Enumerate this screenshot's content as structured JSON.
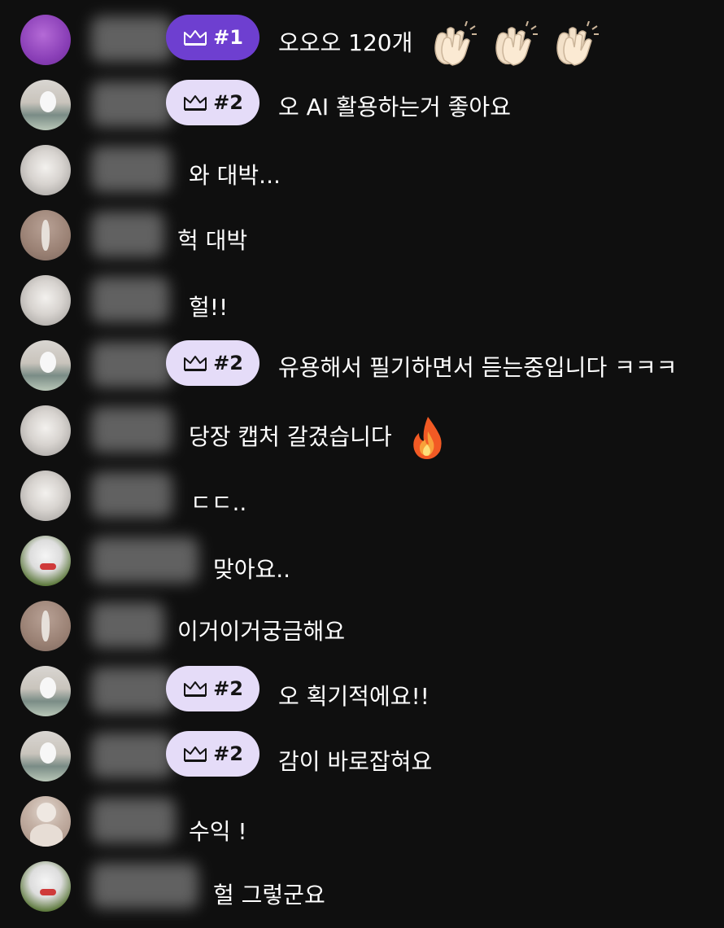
{
  "chat": {
    "messages": [
      {
        "badge": "#1",
        "text": "오오오 120개",
        "emojis": [
          "clapping-hands-icon",
          "clapping-hands-icon",
          "clapping-hands-icon"
        ]
      },
      {
        "badge": "#2",
        "text": "오 AI 활용하는거 좋아요"
      },
      {
        "badge": null,
        "text": "와 대박..."
      },
      {
        "badge": null,
        "text": "헉 대박"
      },
      {
        "badge": null,
        "text": "헐!!"
      },
      {
        "badge": "#2",
        "text": "유용해서 필기하면서 듣는중입니다 ㅋㅋㅋ"
      },
      {
        "badge": null,
        "text": "당장 캡처 갈겼습니다",
        "emojis": [
          "fire-icon"
        ]
      },
      {
        "badge": null,
        "text": "ㄷㄷ.."
      },
      {
        "badge": null,
        "text": "맞아요.."
      },
      {
        "badge": null,
        "text": "이거이거궁금해요"
      },
      {
        "badge": "#2",
        "text": "오 획기적에요!!"
      },
      {
        "badge": "#2",
        "text": "감이 바로잡혀요"
      },
      {
        "badge": null,
        "text": "수익 !"
      },
      {
        "badge": null,
        "text": "헐 그렇군요"
      }
    ]
  },
  "colors": {
    "background": "#0f0f0f",
    "rank1_badge": "#6e3fd0",
    "rank2_badge": "#e5dcf8",
    "text": "#ffffff"
  }
}
